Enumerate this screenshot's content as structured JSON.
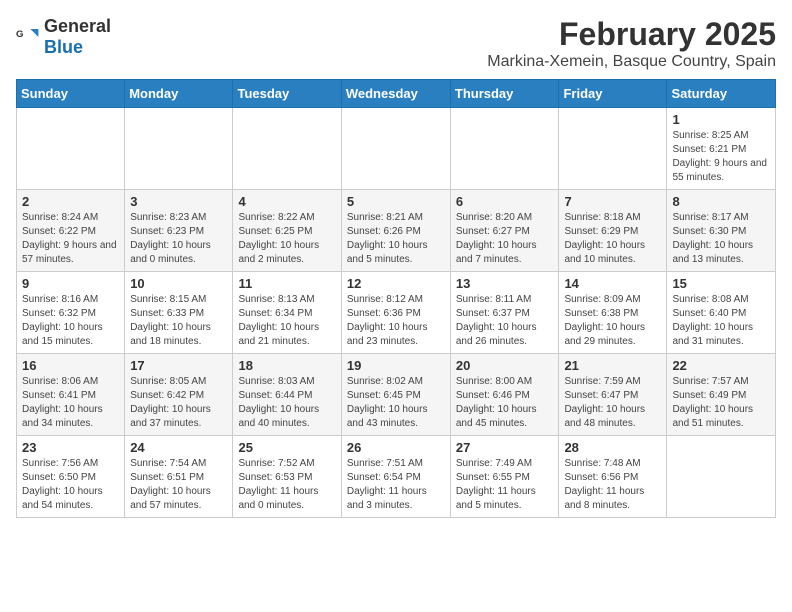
{
  "logo": {
    "general": "General",
    "blue": "Blue"
  },
  "header": {
    "month": "February 2025",
    "location": "Markina-Xemein, Basque Country, Spain"
  },
  "weekdays": [
    "Sunday",
    "Monday",
    "Tuesday",
    "Wednesday",
    "Thursday",
    "Friday",
    "Saturday"
  ],
  "weeks": [
    [
      {
        "day": "",
        "info": ""
      },
      {
        "day": "",
        "info": ""
      },
      {
        "day": "",
        "info": ""
      },
      {
        "day": "",
        "info": ""
      },
      {
        "day": "",
        "info": ""
      },
      {
        "day": "",
        "info": ""
      },
      {
        "day": "1",
        "info": "Sunrise: 8:25 AM\nSunset: 6:21 PM\nDaylight: 9 hours and 55 minutes."
      }
    ],
    [
      {
        "day": "2",
        "info": "Sunrise: 8:24 AM\nSunset: 6:22 PM\nDaylight: 9 hours and 57 minutes."
      },
      {
        "day": "3",
        "info": "Sunrise: 8:23 AM\nSunset: 6:23 PM\nDaylight: 10 hours and 0 minutes."
      },
      {
        "day": "4",
        "info": "Sunrise: 8:22 AM\nSunset: 6:25 PM\nDaylight: 10 hours and 2 minutes."
      },
      {
        "day": "5",
        "info": "Sunrise: 8:21 AM\nSunset: 6:26 PM\nDaylight: 10 hours and 5 minutes."
      },
      {
        "day": "6",
        "info": "Sunrise: 8:20 AM\nSunset: 6:27 PM\nDaylight: 10 hours and 7 minutes."
      },
      {
        "day": "7",
        "info": "Sunrise: 8:18 AM\nSunset: 6:29 PM\nDaylight: 10 hours and 10 minutes."
      },
      {
        "day": "8",
        "info": "Sunrise: 8:17 AM\nSunset: 6:30 PM\nDaylight: 10 hours and 13 minutes."
      }
    ],
    [
      {
        "day": "9",
        "info": "Sunrise: 8:16 AM\nSunset: 6:32 PM\nDaylight: 10 hours and 15 minutes."
      },
      {
        "day": "10",
        "info": "Sunrise: 8:15 AM\nSunset: 6:33 PM\nDaylight: 10 hours and 18 minutes."
      },
      {
        "day": "11",
        "info": "Sunrise: 8:13 AM\nSunset: 6:34 PM\nDaylight: 10 hours and 21 minutes."
      },
      {
        "day": "12",
        "info": "Sunrise: 8:12 AM\nSunset: 6:36 PM\nDaylight: 10 hours and 23 minutes."
      },
      {
        "day": "13",
        "info": "Sunrise: 8:11 AM\nSunset: 6:37 PM\nDaylight: 10 hours and 26 minutes."
      },
      {
        "day": "14",
        "info": "Sunrise: 8:09 AM\nSunset: 6:38 PM\nDaylight: 10 hours and 29 minutes."
      },
      {
        "day": "15",
        "info": "Sunrise: 8:08 AM\nSunset: 6:40 PM\nDaylight: 10 hours and 31 minutes."
      }
    ],
    [
      {
        "day": "16",
        "info": "Sunrise: 8:06 AM\nSunset: 6:41 PM\nDaylight: 10 hours and 34 minutes."
      },
      {
        "day": "17",
        "info": "Sunrise: 8:05 AM\nSunset: 6:42 PM\nDaylight: 10 hours and 37 minutes."
      },
      {
        "day": "18",
        "info": "Sunrise: 8:03 AM\nSunset: 6:44 PM\nDaylight: 10 hours and 40 minutes."
      },
      {
        "day": "19",
        "info": "Sunrise: 8:02 AM\nSunset: 6:45 PM\nDaylight: 10 hours and 43 minutes."
      },
      {
        "day": "20",
        "info": "Sunrise: 8:00 AM\nSunset: 6:46 PM\nDaylight: 10 hours and 45 minutes."
      },
      {
        "day": "21",
        "info": "Sunrise: 7:59 AM\nSunset: 6:47 PM\nDaylight: 10 hours and 48 minutes."
      },
      {
        "day": "22",
        "info": "Sunrise: 7:57 AM\nSunset: 6:49 PM\nDaylight: 10 hours and 51 minutes."
      }
    ],
    [
      {
        "day": "23",
        "info": "Sunrise: 7:56 AM\nSunset: 6:50 PM\nDaylight: 10 hours and 54 minutes."
      },
      {
        "day": "24",
        "info": "Sunrise: 7:54 AM\nSunset: 6:51 PM\nDaylight: 10 hours and 57 minutes."
      },
      {
        "day": "25",
        "info": "Sunrise: 7:52 AM\nSunset: 6:53 PM\nDaylight: 11 hours and 0 minutes."
      },
      {
        "day": "26",
        "info": "Sunrise: 7:51 AM\nSunset: 6:54 PM\nDaylight: 11 hours and 3 minutes."
      },
      {
        "day": "27",
        "info": "Sunrise: 7:49 AM\nSunset: 6:55 PM\nDaylight: 11 hours and 5 minutes."
      },
      {
        "day": "28",
        "info": "Sunrise: 7:48 AM\nSunset: 6:56 PM\nDaylight: 11 hours and 8 minutes."
      },
      {
        "day": "",
        "info": ""
      }
    ]
  ]
}
